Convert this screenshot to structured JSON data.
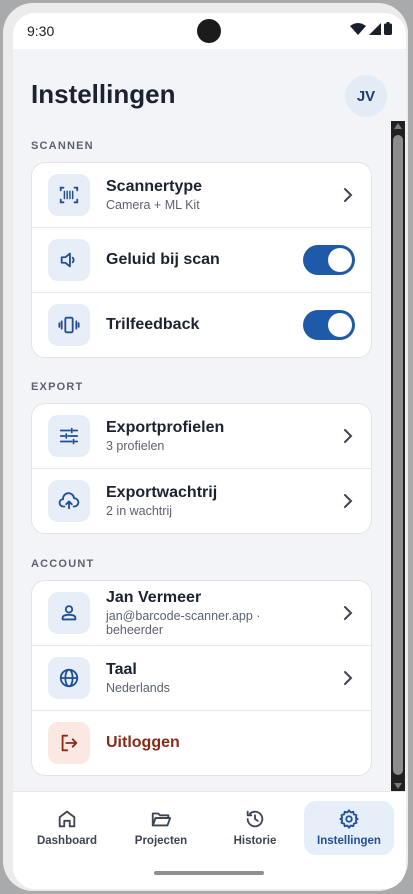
{
  "status": {
    "time": "9:30"
  },
  "header": {
    "title": "Instellingen",
    "avatar_initials": "JV"
  },
  "sections": {
    "scannen": {
      "label": "SCANNEN",
      "items": [
        {
          "title": "Scannertype",
          "subtitle": "Camera + ML Kit",
          "icon": "barcode-scan-icon"
        },
        {
          "title": "Geluid bij scan",
          "icon": "speaker-icon",
          "toggle_on": true
        },
        {
          "title": "Trilfeedback",
          "icon": "vibration-icon",
          "toggle_on": true
        }
      ]
    },
    "export": {
      "label": "EXPORT",
      "items": [
        {
          "title": "Exportprofielen",
          "subtitle": "3 profielen",
          "icon": "sliders-icon"
        },
        {
          "title": "Exportwachtrij",
          "subtitle": "2 in wachtrij",
          "icon": "cloud-upload-icon"
        }
      ]
    },
    "account": {
      "label": "ACCOUNT",
      "items": [
        {
          "title": "Jan Vermeer",
          "subtitle": "jan@barcode-scanner.app · beheerder",
          "icon": "person-icon"
        },
        {
          "title": "Taal",
          "subtitle": "Nederlands",
          "icon": "globe-icon"
        },
        {
          "title": "Uitloggen",
          "icon": "logout-icon"
        }
      ]
    }
  },
  "nav": {
    "items": [
      {
        "label": "Dashboard",
        "icon": "home-icon"
      },
      {
        "label": "Projecten",
        "icon": "folder-icon"
      },
      {
        "label": "Historie",
        "icon": "history-icon"
      },
      {
        "label": "Instellingen",
        "icon": "gear-icon",
        "active": true
      }
    ]
  },
  "colors": {
    "accent": "#1f5aa8",
    "danger": "#8a2a17",
    "background": "#f3f4f7"
  }
}
